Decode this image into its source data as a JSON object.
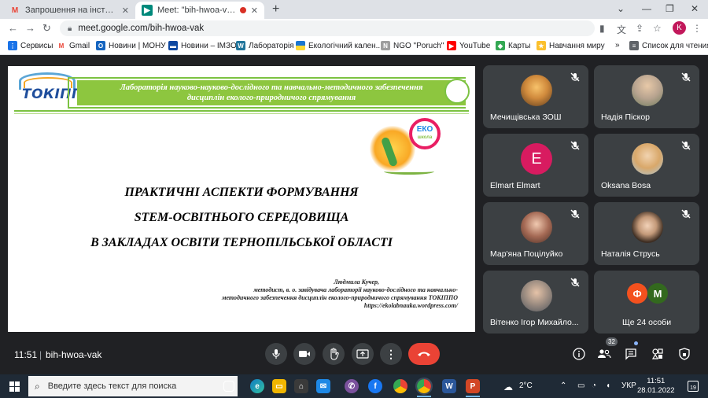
{
  "browser": {
    "tabs": [
      {
        "title": "Запрошення на інструктивно-м",
        "active": false,
        "icon": "gmail-icon"
      },
      {
        "title": "Meet: \"bih-hwoa-vak\"",
        "active": true,
        "icon": "meet-icon"
      }
    ],
    "url": "meet.google.com/bih-hwoa-vak",
    "profile_initial": "K",
    "bookmarks": [
      {
        "label": "Сервисы",
        "icon": "apps-icon"
      },
      {
        "label": "Gmail",
        "icon": "gmail-icon"
      },
      {
        "label": "Новини | МОНУ",
        "icon": "mon-icon"
      },
      {
        "label": "Новини – ІМЗО",
        "icon": "imzo-icon"
      },
      {
        "label": "Лабораторія",
        "icon": "wordpress-icon"
      },
      {
        "label": "Екологічний кален...",
        "icon": "ua-flag-icon"
      },
      {
        "label": "NGO \"Poruch\"",
        "icon": "ngo-icon"
      },
      {
        "label": "YouTube",
        "icon": "youtube-icon"
      },
      {
        "label": "Карты",
        "icon": "maps-icon"
      },
      {
        "label": "Навчання миру",
        "icon": "bookmark-icon"
      },
      {
        "label": "»",
        "icon": "more-icon"
      },
      {
        "label": "Список для чтения",
        "icon": "reading-list-icon"
      }
    ]
  },
  "slide": {
    "header_line1": "Лабораторія науково-науково-дослідного та навчально-методичного забезпечення",
    "header_line2": "дисциплін еколого-природничого спрямування",
    "logo_text": "ТОКІППО",
    "eko_logo_text": "ЕКО",
    "eko_logo_sub": "школа",
    "title_lines": [
      "ПРАКТИЧНІ АСПЕКТИ ФОРМУВАННЯ",
      "STEM-ОСВІТНЬОГО СЕРЕДОВИЩА",
      "В ЗАКЛАДАХ ОСВІТИ ТЕРНОПІЛЬСЬКОЇ ОБЛАСТІ"
    ],
    "author_name": "Людмила Кучер,",
    "author_lines": [
      "методист, в. о. завідувача лабораторії науково-дослідного та навчально-",
      "методичного забезпечення дисциплін еколого-природничого спрямування ТОКІППО",
      "https://ekolabnauka.wordpress.com/"
    ]
  },
  "participants": [
    {
      "name": "Мечищівська ЗОШ",
      "avatar": "photo",
      "color": "#c97a3a"
    },
    {
      "name": "Надія Піскор",
      "avatar": "photo",
      "color": "#b7a38f"
    },
    {
      "name": "Elmart Elmart",
      "avatar": "letter",
      "letter": "E",
      "color": "#d81b60"
    },
    {
      "name": "Oksana Bosa",
      "avatar": "photo",
      "color": "#d9a86a"
    },
    {
      "name": "Мар'яна Поцілуйко",
      "avatar": "photo",
      "color": "#8a5a4a"
    },
    {
      "name": "Наталія Струсь",
      "avatar": "photo",
      "color": "#5a4a3a"
    },
    {
      "name": "Вітенко Ігор Михайло...",
      "avatar": "photo",
      "color": "#6a6f78"
    }
  ],
  "others": {
    "label": "Ще 24 особи",
    "avatars": [
      {
        "letter": "Ф",
        "color": "#f4511e"
      },
      {
        "letter": "М",
        "color": "#33691e"
      }
    ]
  },
  "meeting": {
    "time": "11:51",
    "separator": "|",
    "code": "bih-hwoa-vak",
    "people_count": "32"
  },
  "taskbar": {
    "search_placeholder": "Введите здесь текст для поиска",
    "weather": "2°C",
    "language": "УКР",
    "time": "11:51",
    "date": "28.01.2022",
    "notifications": "19"
  },
  "colors": {
    "meet_bg": "#202124",
    "tile_bg": "#3c4043",
    "end_call": "#ea4335",
    "slide_green": "#8dc63f"
  }
}
